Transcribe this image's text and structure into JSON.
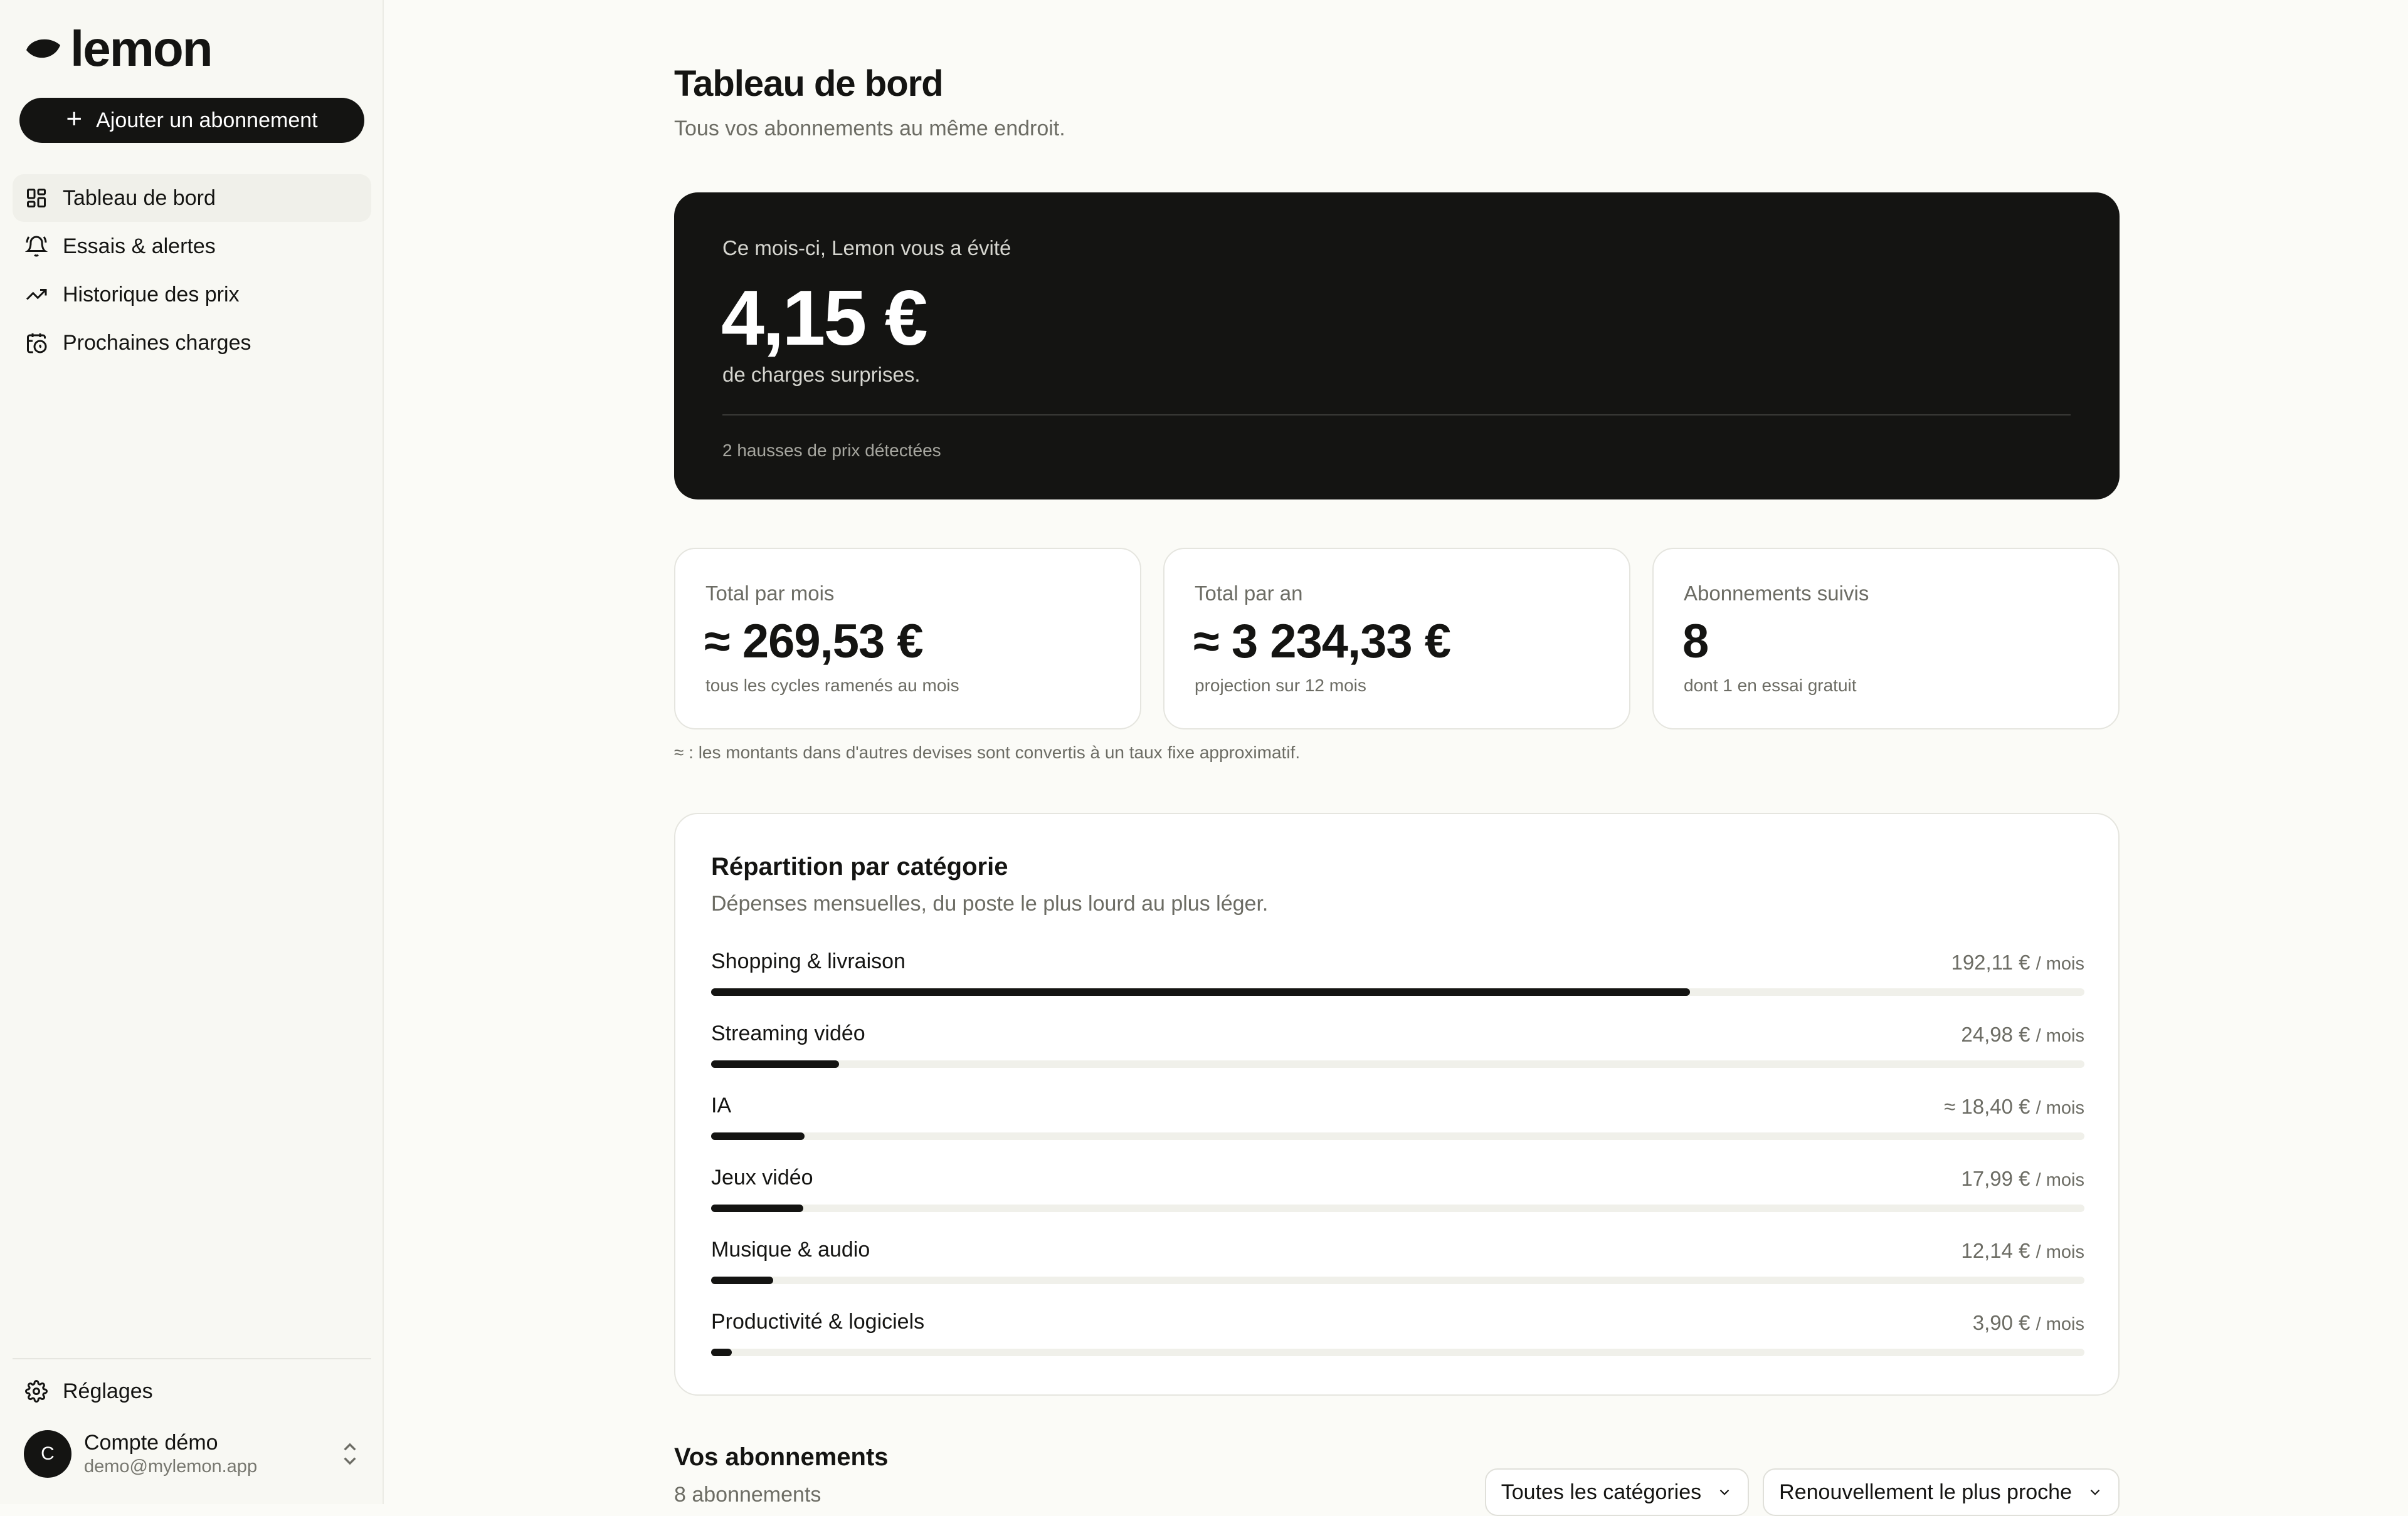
{
  "app": {
    "name": "lemon"
  },
  "sidebar": {
    "add_button": "Ajouter un abonnement",
    "items": [
      {
        "label": "Tableau de bord",
        "icon": "dashboard-icon",
        "active": true
      },
      {
        "label": "Essais & alertes",
        "icon": "bell-icon",
        "active": false
      },
      {
        "label": "Historique des prix",
        "icon": "trending-up-icon",
        "active": false
      },
      {
        "label": "Prochaines charges",
        "icon": "calendar-clock-icon",
        "active": false
      }
    ],
    "settings": "Réglages",
    "account": {
      "initial": "C",
      "name": "Compte démo",
      "email": "demo@mylemon.app"
    }
  },
  "header": {
    "title": "Tableau de bord",
    "subtitle": "Tous vos abonnements au même endroit."
  },
  "hero": {
    "label": "Ce mois-ci, Lemon vous a évité",
    "value": "4,15 €",
    "description": "de charges surprises.",
    "footnote": "2 hausses de prix détectées"
  },
  "stats": [
    {
      "label": "Total par mois",
      "value": "≈ 269,53 €",
      "sub": "tous les cycles ramenés au mois"
    },
    {
      "label": "Total par an",
      "value": "≈ 3 234,33 €",
      "sub": "projection sur 12 mois"
    },
    {
      "label": "Abonnements suivis",
      "value": "8",
      "sub": "dont 1 en essai gratuit"
    }
  ],
  "disclaimer": "≈ : les montants dans d'autres devises sont convertis à un taux fixe approximatif.",
  "categories": {
    "title": "Répartition par catégorie",
    "subtitle": "Dépenses mensuelles, du poste le plus lourd au plus léger.",
    "per_label": "/ mois",
    "items": [
      {
        "name": "Shopping & livraison",
        "amount": "192,11 €",
        "share": 0.713
      },
      {
        "name": "Streaming vidéo",
        "amount": "24,98 €",
        "share": 0.093
      },
      {
        "name": "IA",
        "amount": "≈ 18,40 €",
        "share": 0.068
      },
      {
        "name": "Jeux vidéo",
        "amount": "17,99 €",
        "share": 0.067
      },
      {
        "name": "Musique & audio",
        "amount": "12,14 €",
        "share": 0.045
      },
      {
        "name": "Productivité & logiciels",
        "amount": "3,90 €",
        "share": 0.015
      }
    ]
  },
  "subscriptions": {
    "title": "Vos abonnements",
    "count": "8 abonnements",
    "filter_category": "Toutes les catégories",
    "filter_sort": "Renouvellement le plus proche"
  }
}
